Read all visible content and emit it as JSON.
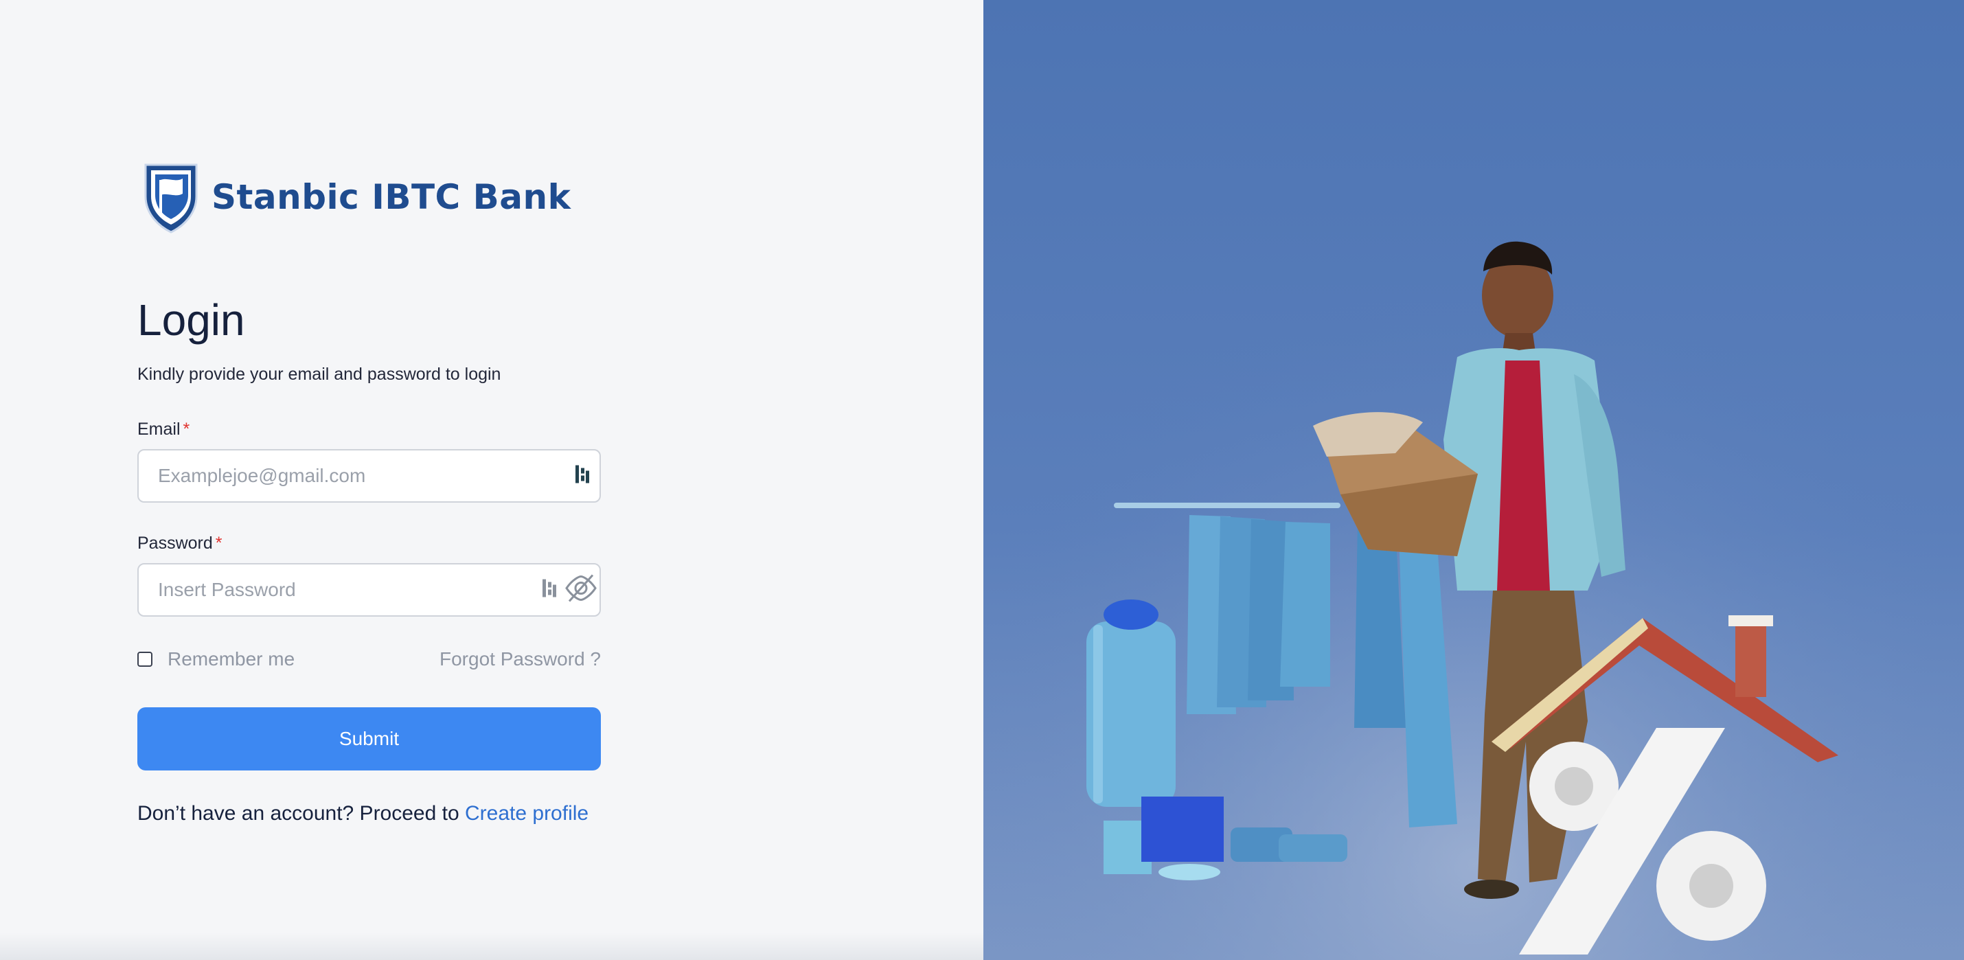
{
  "brand": {
    "name": "Stanbic IBTC Bank",
    "color": "#1f4c8f"
  },
  "login": {
    "title": "Login",
    "subtitle": "Kindly provide your email and password to login",
    "email_label": "Email",
    "email_placeholder": "Examplejoe@gmail.com",
    "password_label": "Password",
    "password_placeholder": "Insert Password",
    "required_mark": "*",
    "remember_label": "Remember me",
    "remember_checked": false,
    "forgot_label": "Forgot Password ?",
    "submit_label": "Submit",
    "signup_prompt": "Don’t have an account? Proceed to",
    "signup_link": "Create profile"
  },
  "icons": {
    "field_icon": "password-manager-icon",
    "visibility_icon": "eye-off-icon"
  },
  "colors": {
    "accent": "#3d88f2",
    "link": "#2e6fd0",
    "required": "#e0322e",
    "hero_background": "#4d74b3"
  }
}
